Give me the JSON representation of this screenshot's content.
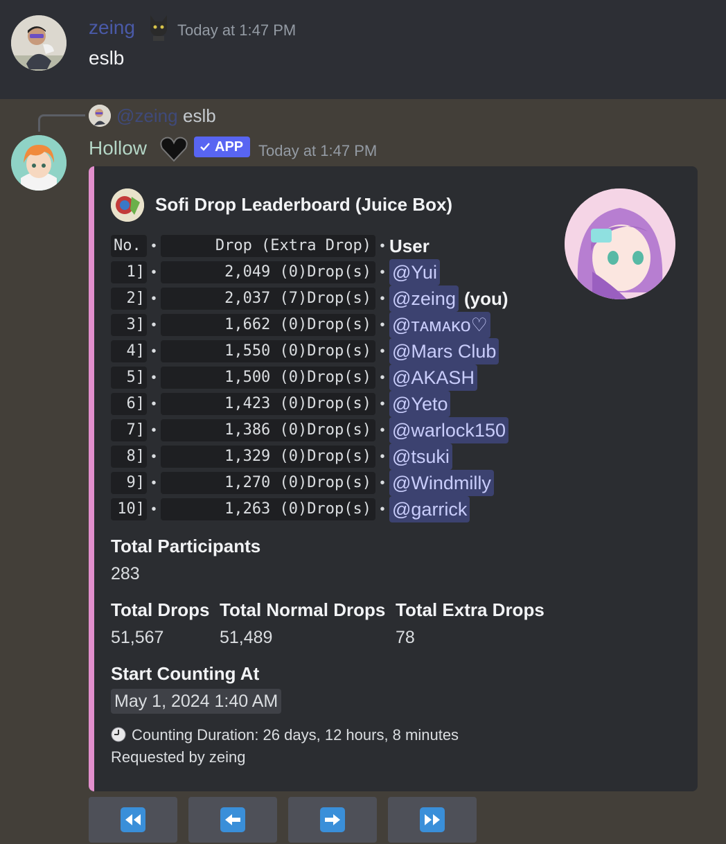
{
  "message1": {
    "author": "zeing",
    "timestamp": "Today at 1:47 PM",
    "content": "eslb"
  },
  "reply": {
    "author": "@zeing",
    "content": "eslb"
  },
  "message2": {
    "author": "Hollow",
    "app_badge": "APP",
    "timestamp": "Today at 1:47 PM"
  },
  "embed": {
    "title": "Sofi Drop Leaderboard (Juice Box)",
    "header": {
      "no": "No.",
      "drop": "Drop (Extra Drop)",
      "user": "User"
    },
    "rows": [
      {
        "rank": "1]",
        "drops": "2,049 (0)Drop(s)",
        "user": "@Yui",
        "suffix": ""
      },
      {
        "rank": "2]",
        "drops": "2,037 (7)Drop(s)",
        "user": "@zeing",
        "suffix": "(you)"
      },
      {
        "rank": "3]",
        "drops": "1,662 (0)Drop(s)",
        "user": "@ᴛᴀᴍᴀᴋᴏ♡",
        "suffix": ""
      },
      {
        "rank": "4]",
        "drops": "1,550 (0)Drop(s)",
        "user": "@Mars Club",
        "suffix": ""
      },
      {
        "rank": "5]",
        "drops": "1,500 (0)Drop(s)",
        "user": "@AKASH",
        "suffix": ""
      },
      {
        "rank": "6]",
        "drops": "1,423 (0)Drop(s)",
        "user": "@Yeto",
        "suffix": ""
      },
      {
        "rank": "7]",
        "drops": "1,386 (0)Drop(s)",
        "user": "@warlock150",
        "suffix": ""
      },
      {
        "rank": "8]",
        "drops": "1,329 (0)Drop(s)",
        "user": "@tsuki",
        "suffix": ""
      },
      {
        "rank": "9]",
        "drops": "1,270 (0)Drop(s)",
        "user": "@Windmilly",
        "suffix": ""
      },
      {
        "rank": "10]",
        "drops": "1,263 (0)Drop(s)",
        "user": "@garrick",
        "suffix": ""
      }
    ],
    "total_participants_label": "Total Participants",
    "total_participants": "283",
    "total_drops_label": "Total Drops",
    "total_drops": "51,567",
    "total_normal_label": "Total Normal Drops",
    "total_normal": "51,489",
    "total_extra_label": "Total Extra Drops",
    "total_extra": "78",
    "start_label": "Start Counting At",
    "start_value": "May 1, 2024 1:40 AM",
    "duration": "Counting Duration: 26 days, 12 hours, 8 minutes",
    "requested_by": "Requested by zeing"
  },
  "buttons": [
    "first-page",
    "previous-page",
    "next-page",
    "last-page"
  ],
  "colors": {
    "embed_accent": "#e28fcd",
    "mention_bg": "#3c4270",
    "app_badge": "#5865f2",
    "button_icon": "#3a8fd9"
  }
}
